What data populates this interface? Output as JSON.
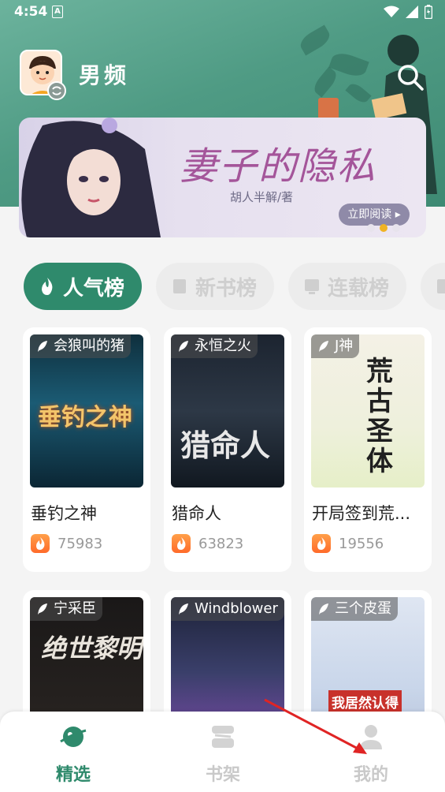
{
  "status_bar": {
    "time": "4:54",
    "notify_letter": "A"
  },
  "header": {
    "channel": "男频",
    "search_icon": "search-icon"
  },
  "banner": {
    "title": "妻子的隐私",
    "author": "胡人半解/著",
    "read_button": "立即阅读 ▸",
    "active_dot": 2
  },
  "rank_tabs": [
    {
      "label": "人气榜",
      "active": true
    },
    {
      "label": "新书榜",
      "active": false
    },
    {
      "label": "连载榜",
      "active": false
    }
  ],
  "books": [
    {
      "author": "会狼叫的猪",
      "name": "垂钓之神",
      "hot": "75983",
      "cover_text": "垂钓之神"
    },
    {
      "author": "永恒之火",
      "name": "猎命人",
      "hot": "63823",
      "cover_text": "猎命人"
    },
    {
      "author": "J神",
      "name": "开局签到荒...",
      "hot": "19556",
      "cover_text": "荒古圣体"
    },
    {
      "author": "宁采臣",
      "name": "",
      "hot": "",
      "cover_text": "绝世黎明"
    },
    {
      "author": "Windblower",
      "name": "",
      "hot": "",
      "cover_text": ""
    },
    {
      "author": "三个皮蛋",
      "name": "",
      "hot": "",
      "cover_text": "我居然认得"
    }
  ],
  "bottom_nav": [
    {
      "label": "精选",
      "active": true
    },
    {
      "label": "书架",
      "active": false
    },
    {
      "label": "我的",
      "active": false
    }
  ],
  "colors": {
    "accent": "#2f8a6c",
    "header": "#4f9b84",
    "banner_title": "#a4559a",
    "hot": "#ff7a33"
  }
}
